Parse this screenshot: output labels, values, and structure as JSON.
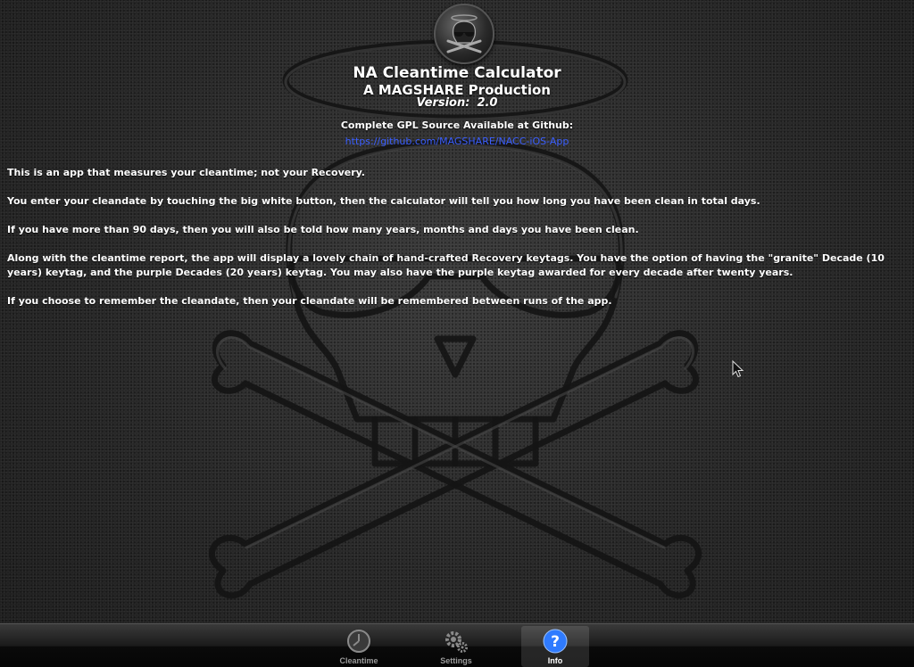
{
  "header": {
    "title": "NA Cleantime Calculator",
    "subtitle": "A MAGSHARE Production",
    "version_label": "Version:",
    "version_value": "2.0",
    "source_label": "Complete GPL Source Available at Github:",
    "source_url": "https://github.com/MAGSHARE/NACC-iOS-App"
  },
  "body": {
    "paragraphs": [
      "This is an app that measures your cleantime; not your Recovery.",
      "You enter your cleandate by touching the big white button, then the calculator will tell you how long you have been clean in total days.",
      "If you have more than 90 days, then you will also be told how many years, months and days you have been clean.",
      "Along with the cleantime report, the app will display a lovely chain of hand-crafted Recovery keytags. You have the option of having the \"granite\" Decade (10 years) keytag, and the purple Decades (20 years) keytag. You may also have the purple keytag awarded for every decade after twenty years.",
      "If you choose to remember the cleandate, then your cleandate will be remembered between runs of the app."
    ]
  },
  "tabbar": {
    "selected": "Info",
    "tabs": [
      {
        "label": "Cleantime",
        "icon": "clock-icon"
      },
      {
        "label": "Settings",
        "icon": "gears-icon"
      },
      {
        "label": "Info",
        "icon": "question-mark-icon"
      }
    ]
  },
  "colors": {
    "link": "#3b5fff",
    "info_icon": "#2f7bff",
    "text": "#ffffff"
  }
}
